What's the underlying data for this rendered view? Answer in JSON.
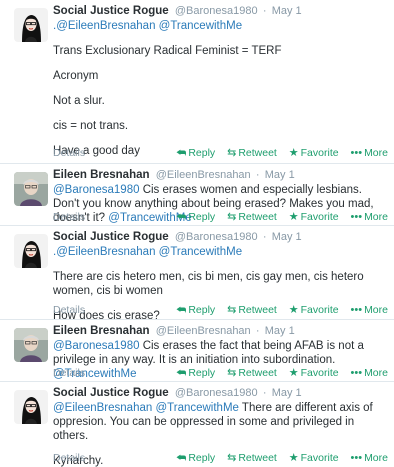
{
  "actions": {
    "details": "Details",
    "reply": "Reply",
    "retweet": "Retweet",
    "favorite": "Favorite",
    "more": "More",
    "reply_icon": "reply-arrow-icon",
    "retweet_icon": "retweet-icon",
    "favorite_icon": "star-icon",
    "more_icon": "ellipsis-icon"
  },
  "colors": {
    "mention": "#2b7bb9",
    "action": "#1e9e6e",
    "meta": "#8899a6",
    "divider": "#e1e8ed"
  },
  "tweets": [
    {
      "fullname": "Social Justice Rogue",
      "screenname": "@Baronesa1980",
      "separator": "·",
      "time": "May 1",
      "mentions": ".@EileenBresnahan @TrancewithMe",
      "paragraphs": [
        "Trans Exclusionary Radical Feminist = TERF",
        "Acronym",
        "Not a slur.",
        "cis = not trans.",
        "Have a good day"
      ]
    },
    {
      "fullname": "Eileen Bresnahan",
      "screenname": "@EileenBresnahan",
      "separator": "·",
      "time": "May 1",
      "lead_mention": "@Baronesa1980",
      "body": " Cis erases women and especially lesbians. Don't you know anything about being erased? Makes you mad, doesn't it? ",
      "trail_mention": "@TrancewithMe"
    },
    {
      "fullname": "Social Justice Rogue",
      "screenname": "@Baronesa1980",
      "separator": "·",
      "time": "May 1",
      "mentions": ".@EileenBresnahan @TrancewithMe",
      "paragraphs": [
        "There are cis hetero men, cis bi men, cis gay men, cis hetero women, cis bi women",
        "How does cis erase?"
      ]
    },
    {
      "fullname": "Eileen Bresnahan",
      "screenname": "@EileenBresnahan",
      "separator": "·",
      "time": "May 1",
      "lead_mention": "@Baronesa1980",
      "body": " Cis erases the fact that being AFAB is not a privilege in any way. It is an initiation into subordination. ",
      "trail_mention": "@TrancewithMe"
    },
    {
      "fullname": "Social Justice Rogue",
      "screenname": "@Baronesa1980",
      "separator": "·",
      "time": "May 1",
      "lead_mention": "@EileenBresnahan @TrancewithMe",
      "body": " There are different axis of oppresion. You can be oppressed in some and privileged in others.",
      "paragraphs": [
        "Kyriarchy."
      ]
    }
  ]
}
